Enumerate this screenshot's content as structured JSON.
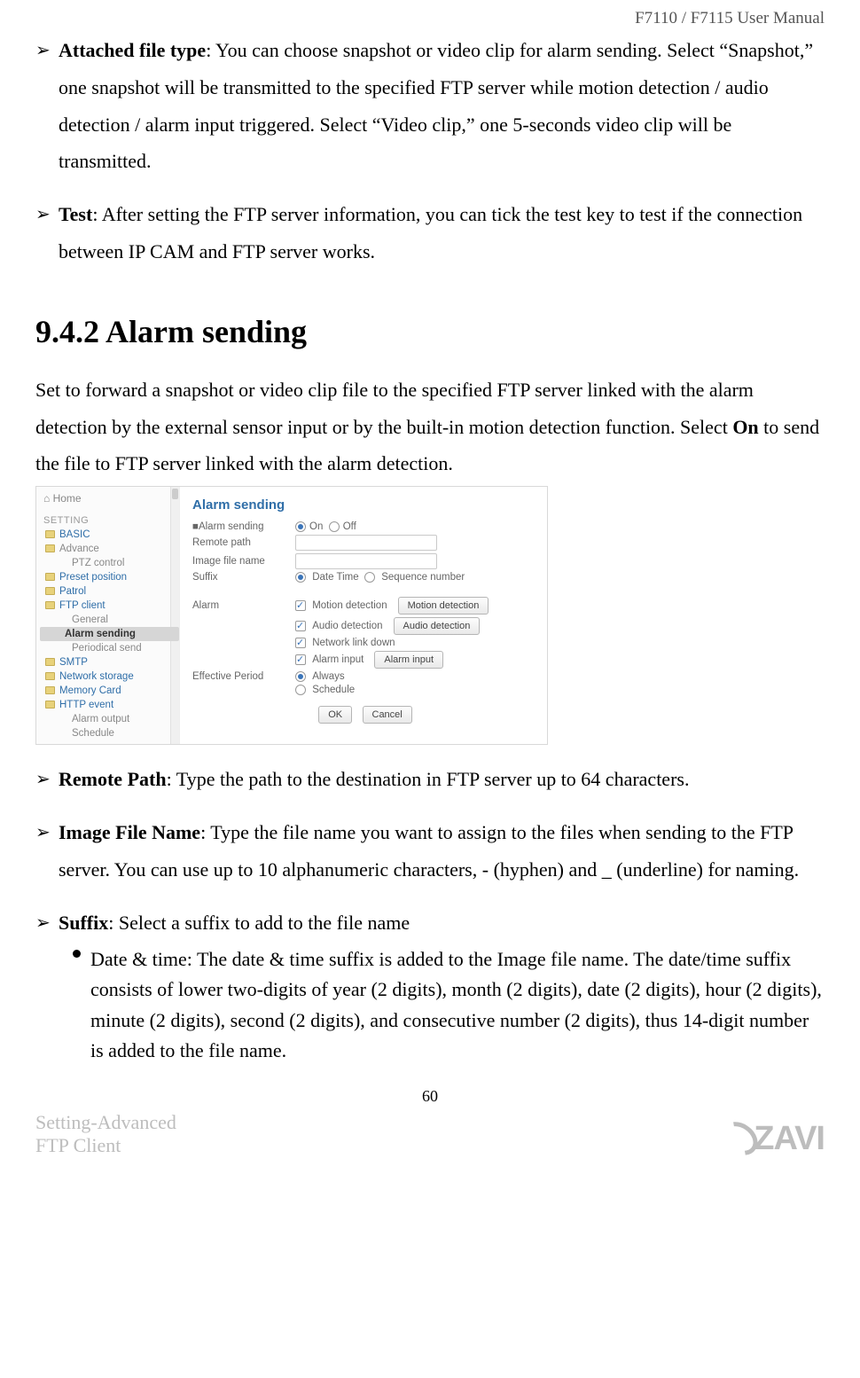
{
  "header": {
    "doc_title": "F7110 / F7115 User Manual"
  },
  "bullets_top": [
    {
      "label": "Attached file type",
      "text": ": You can choose snapshot or video clip for alarm sending. Select “Snapshot,” one snapshot will be transmitted to the specified FTP server while motion detection / audio detection / alarm input triggered. Select “Video clip,” one 5-seconds video clip will be transmitted."
    },
    {
      "label": "Test",
      "text": ": After setting the FTP server information, you can tick the test key to test if the connection between IP CAM and FTP server works."
    }
  ],
  "section": {
    "title": "9.4.2 Alarm sending",
    "intro_1": "Set to forward a snapshot or video clip file to the specified FTP server linked with the alarm detection by the external sensor input or by the built-in motion detection function. Select ",
    "intro_bold": "On",
    "intro_2": " to send the file to FTP server linked with the alarm detection."
  },
  "sidebar": {
    "home": "Home",
    "heading": "SETTING",
    "items": {
      "basic": "BASIC",
      "advance": "Advance",
      "ptz": "PTZ control",
      "preset": "Preset position",
      "patrol": "Patrol",
      "ftp": "FTP client",
      "general": "General",
      "alarm_sending": "Alarm sending",
      "periodical": "Periodical send",
      "smtp": "SMTP",
      "netstorage": "Network storage",
      "memcard": "Memory Card",
      "httpevent": "HTTP event",
      "alarmout": "Alarm output",
      "schedule": "Schedule"
    }
  },
  "panel": {
    "title": "Alarm sending",
    "row_alarm_sending": "Alarm sending",
    "on": "On",
    "off": "Off",
    "remote_path": "Remote path",
    "image_file_name": "Image file name",
    "suffix": "Suffix",
    "date_time": "Date Time",
    "sequence": "Sequence number",
    "alarm": "Alarm",
    "motion_det": "Motion detection",
    "audio_det": "Audio detection",
    "net_link_down": "Network link down",
    "alarm_input": "Alarm input",
    "btn_motion": "Motion detection",
    "btn_audio": "Audio detection",
    "btn_alarm": "Alarm input",
    "effective": "Effective Period",
    "always": "Always",
    "scheduleopt": "Schedule",
    "ok": "OK",
    "cancel": "Cancel"
  },
  "bullets_bottom": [
    {
      "label": "Remote Path",
      "text": ": Type the path to the destination in FTP server up to 64 characters."
    },
    {
      "label": "Image File Name",
      "text": ": Type the file name you want to assign to the files when sending to the FTP server. You can use up to 10 alphanumeric characters, - (hyphen) and _ (underline) for naming."
    },
    {
      "label": "Suffix",
      "text": ": Select a suffix to add to the file name"
    }
  ],
  "sub_bullet": {
    "label": "Date & time",
    "text": ": The date & time suffix is added to the Image file name. The date/time suffix consists of lower two-digits of year (2 digits), month (2 digits), date (2 digits), hour (2 digits), minute (2 digits), second (2 digits), and consecutive number (2 digits), thus 14-digit number is added to the file name."
  },
  "footer": {
    "line1": "Setting-Advanced",
    "line2": "FTP Client",
    "page": "60",
    "logo": "ZAVI"
  }
}
